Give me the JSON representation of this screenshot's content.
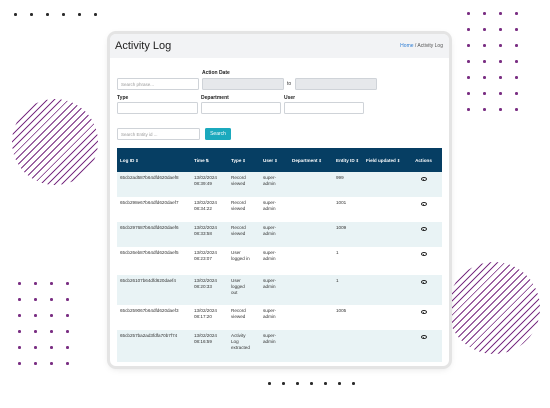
{
  "header": {
    "title": "Activity Log",
    "breadcrumb_home": "Home",
    "breadcrumb_sep": "/",
    "breadcrumb_current": "Activity Log"
  },
  "filters": {
    "search_placeholder": "Search phrase...",
    "action_date_label": "Action Date",
    "to_label": "to",
    "type_label": "Type",
    "department_label": "Department",
    "user_label": "User",
    "entity_placeholder": "Search Entity id ...",
    "search_button": "Search"
  },
  "table": {
    "columns": [
      "Log ID",
      "Time",
      "Type",
      "User",
      "Department",
      "Entity ID",
      "Field updated",
      "Actions"
    ],
    "rows": [
      {
        "log_id": "65cb2ad587b64dfd620daef8",
        "date": "13/02/2024",
        "time": "08:39:49",
        "type": [
          "Record",
          "viewed"
        ],
        "user": [
          "super-",
          "admin"
        ],
        "department": "",
        "entity": "999",
        "field": ""
      },
      {
        "log_id": "65cb298e67b64dfd620daef7",
        "date": "13/02/2024",
        "time": "08:34:22",
        "type": [
          "Record",
          "viewed"
        ],
        "user": [
          "super-",
          "admin"
        ],
        "department": "",
        "entity": "1001",
        "field": ""
      },
      {
        "log_id": "65cb297687b64dfd620daef6",
        "date": "13/02/2024",
        "time": "08:33:58",
        "type": [
          "Record",
          "viewed"
        ],
        "user": [
          "super-",
          "admin"
        ],
        "department": "",
        "entity": "1009",
        "field": ""
      },
      {
        "log_id": "65cb26eb87b64dfd620daef5",
        "date": "13/02/2024",
        "time": "08:23:07",
        "type": [
          "User",
          "logged in"
        ],
        "user": [
          "super-",
          "admin"
        ],
        "department": "",
        "entity": "1",
        "field": ""
      },
      {
        "log_id": "65cb26107b64dfd620daef4",
        "date": "13/02/2024",
        "time": "08:20:33",
        "type": [
          "User",
          "logged",
          "out"
        ],
        "user": [
          "super-",
          "admin"
        ],
        "department": "",
        "entity": "1",
        "field": ""
      },
      {
        "log_id": "65cb259067b64dfd620daef3",
        "date": "13/02/2024",
        "time": "08:17:20",
        "type": [
          "Record",
          "viewed"
        ],
        "user": [
          "super-",
          "admin"
        ],
        "department": "",
        "entity": "1005",
        "field": ""
      },
      {
        "log_id": "65cb257ba2ad3fdfa70b7f74",
        "date": "13/02/2024",
        "time": "08:16:59",
        "type": [
          "Activity",
          "Log",
          "extracted"
        ],
        "user": [
          "super-",
          "admin"
        ],
        "department": "",
        "entity": "",
        "field": ""
      }
    ]
  },
  "colors": {
    "header_bg": "#063e63",
    "accent": "#1ba9bd",
    "row_alt": "#e9f3f5",
    "decor": "#7a2f83"
  },
  "icons": {
    "view": "eye-icon",
    "sort": "sort-icon"
  }
}
